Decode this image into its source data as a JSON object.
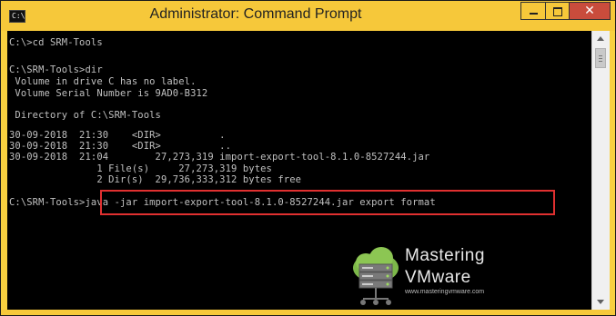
{
  "window": {
    "title": "Administrator: Command Prompt",
    "app_icon_text": "C:\\",
    "close_glyph": "✕"
  },
  "console": {
    "lines": [
      "C:\\>cd SRM-Tools",
      "",
      "C:\\SRM-Tools>dir",
      " Volume in drive C has no label.",
      " Volume Serial Number is 9AD0-B312",
      "",
      " Directory of C:\\SRM-Tools",
      "",
      "30-09-2018  21:30    <DIR>          .",
      "30-09-2018  21:30    <DIR>          ..",
      "30-09-2018  21:04        27,273,319 import-export-tool-8.1.0-8527244.jar",
      "               1 File(s)     27,273,319 bytes",
      "               2 Dir(s)  29,736,333,312 bytes free",
      "",
      "C:\\SRM-Tools>java -jar import-export-tool-8.1.0-8527244.jar export format"
    ]
  },
  "watermark": {
    "line1": "Mastering",
    "line2": "VMware",
    "url": "www.masteringvmware.com"
  },
  "colors": {
    "title_bar": "#f6c83a",
    "console_bg": "#000000",
    "console_fg": "#c0c0c0",
    "highlight_box": "#e03030",
    "close_button": "#c94c3c"
  }
}
